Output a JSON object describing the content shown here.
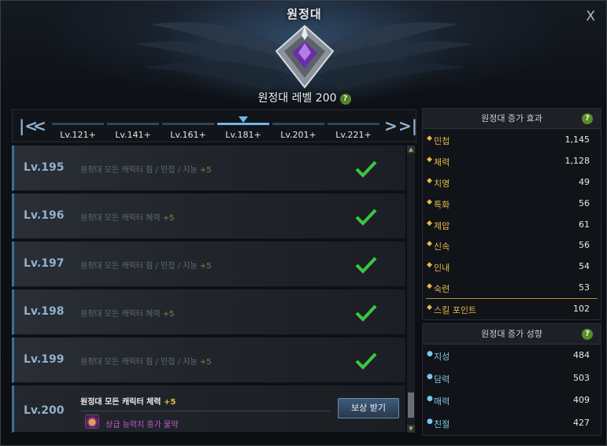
{
  "window": {
    "title": "원정대",
    "close_label": "X",
    "level_label": "원정대 레벨 200",
    "help_label": "?"
  },
  "tabs": {
    "items": [
      {
        "label": "Lv.121+",
        "active": false
      },
      {
        "label": "Lv.141+",
        "active": false
      },
      {
        "label": "Lv.161+",
        "active": false
      },
      {
        "label": "Lv.181+",
        "active": true
      },
      {
        "label": "Lv.201+",
        "active": false
      },
      {
        "label": "Lv.221+",
        "active": false
      }
    ],
    "first_label": "K",
    "prev_label": "<",
    "next_label": ">",
    "last_label": "K"
  },
  "levels": [
    {
      "level": "Lv.195",
      "desc": "원정대 모든 캐릭터 힘 / 민첩 / 지능",
      "bonus": "+5",
      "claimed": true
    },
    {
      "level": "Lv.196",
      "desc": "원정대 모든 캐릭터 체력",
      "bonus": "+5",
      "claimed": true
    },
    {
      "level": "Lv.197",
      "desc": "원정대 모든 캐릭터 힘 / 민첩 / 지능",
      "bonus": "+5",
      "claimed": true
    },
    {
      "level": "Lv.198",
      "desc": "원정대 모든 캐릭터 체력",
      "bonus": "+5",
      "claimed": true
    },
    {
      "level": "Lv.199",
      "desc": "원정대 모든 캐릭터 힘 / 민첩 / 지능",
      "bonus": "+5",
      "claimed": true
    },
    {
      "level": "Lv.200",
      "desc": "원정대 모든 캐릭터 체력",
      "bonus": "+5",
      "claimed": false,
      "reward": "상급 능력치 증가 물약",
      "button": "보상 받기"
    }
  ],
  "effects_panel": {
    "title": "원정대 증가 효과",
    "stats": [
      {
        "name": "민첩",
        "value": "1,145"
      },
      {
        "name": "체력",
        "value": "1,128"
      },
      {
        "name": "치명",
        "value": "49"
      },
      {
        "name": "특화",
        "value": "56"
      },
      {
        "name": "제압",
        "value": "61"
      },
      {
        "name": "신속",
        "value": "56"
      },
      {
        "name": "인내",
        "value": "54"
      },
      {
        "name": "숙련",
        "value": "53"
      },
      {
        "name": "스킬 포인트",
        "value": "102"
      }
    ]
  },
  "tendency_panel": {
    "title": "원정대 증가 성향",
    "stats": [
      {
        "name": "지성",
        "value": "484"
      },
      {
        "name": "담력",
        "value": "503"
      },
      {
        "name": "매력",
        "value": "409"
      },
      {
        "name": "친절",
        "value": "427"
      }
    ]
  },
  "scrollbar": {
    "up_label": "▲",
    "down_label": "▼"
  }
}
